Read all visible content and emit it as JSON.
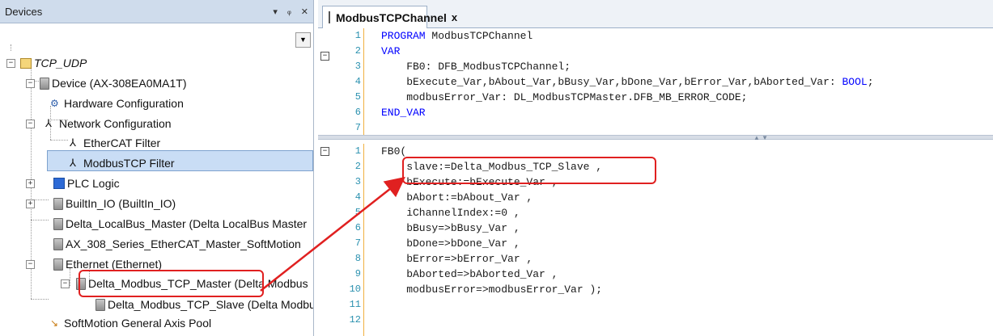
{
  "devices_panel": {
    "title": "Devices",
    "controls": [
      "▾",
      "ᵩ",
      "✕"
    ],
    "tree": [
      {
        "label": "TCP_UDP",
        "italic": true,
        "icon": "project-icon"
      },
      {
        "label": "Device (AX-308EA0MA1T)",
        "icon": "device-icon"
      },
      {
        "label": "Hardware Configuration",
        "icon": "hardware-config-icon"
      },
      {
        "label": "Network Configuration",
        "icon": "network-config-icon"
      },
      {
        "label": "EtherCAT Filter",
        "icon": "network-icon"
      },
      {
        "label": "ModbusTCP Filter",
        "icon": "network-icon"
      },
      {
        "label": "PLC Logic",
        "icon": "plc-logic-icon"
      },
      {
        "label": "BuiltIn_IO (BuiltIn_IO)",
        "icon": "device-icon"
      },
      {
        "label": "Delta_LocalBus_Master (Delta LocalBus Master",
        "icon": "device-icon"
      },
      {
        "label": "AX_308_Series_EtherCAT_Master_SoftMotion",
        "icon": "device-icon"
      },
      {
        "label": "Ethernet (Ethernet)",
        "icon": "device-icon"
      },
      {
        "label": "Delta_Modbus_TCP_Master (Delta Modbus",
        "icon": "device-icon"
      },
      {
        "label": "Delta_Modbus_TCP_Slave (Delta Modbu",
        "icon": "device-icon"
      },
      {
        "label": "SoftMotion General Axis Pool",
        "icon": "axis-pool-icon"
      }
    ]
  },
  "editor": {
    "tab_label": "ModbusTCPChannel",
    "tab_close": "x",
    "declaration": [
      {
        "n": "1",
        "segs": [
          {
            "t": "PROGRAM",
            "kw": true
          },
          {
            "t": " ModbusTCPChannel"
          }
        ]
      },
      {
        "n": "2",
        "segs": [
          {
            "t": "VAR",
            "kw": true
          }
        ]
      },
      {
        "n": "3",
        "segs": [
          {
            "t": "    FB0: DFB_ModbusTCPChannel;"
          }
        ]
      },
      {
        "n": "4",
        "segs": [
          {
            "t": "    bExecute_Var,bAbout_Var,bBusy_Var,bDone_Var,bError_Var,bAborted_Var: "
          },
          {
            "t": "BOOL",
            "kw": true
          },
          {
            "t": ";"
          }
        ]
      },
      {
        "n": "5",
        "segs": [
          {
            "t": "    modbusError_Var: DL_ModbusTCPMaster.DFB_MB_ERROR_CODE;"
          }
        ]
      },
      {
        "n": "6",
        "segs": [
          {
            "t": "END_VAR",
            "kw": true
          }
        ]
      },
      {
        "n": "7",
        "segs": []
      }
    ],
    "body": [
      {
        "n": "1",
        "segs": [
          {
            "t": "FB0("
          }
        ]
      },
      {
        "n": "2",
        "segs": [
          {
            "t": "    slave:=Delta_Modbus_TCP_Slave ,"
          }
        ]
      },
      {
        "n": "3",
        "segs": [
          {
            "t": "    bExecute:=bExecute_Var ,"
          }
        ]
      },
      {
        "n": "4",
        "segs": [
          {
            "t": "    bAbort:=bAbout_Var ,"
          }
        ]
      },
      {
        "n": "5",
        "segs": [
          {
            "t": "    iChannelIndex:=0 ,"
          }
        ]
      },
      {
        "n": "6",
        "segs": [
          {
            "t": "    bBusy=>bBusy_Var ,"
          }
        ]
      },
      {
        "n": "7",
        "segs": [
          {
            "t": "    bDone=>bDone_Var ,"
          }
        ]
      },
      {
        "n": "8",
        "segs": [
          {
            "t": "    bError=>bError_Var ,"
          }
        ]
      },
      {
        "n": "9",
        "segs": [
          {
            "t": "    bAborted=>bAborted_Var ,"
          }
        ]
      },
      {
        "n": "10",
        "segs": [
          {
            "t": "    modbusError=>modbusError_Var );"
          }
        ]
      },
      {
        "n": "11",
        "segs": []
      },
      {
        "n": "12",
        "segs": []
      }
    ]
  },
  "annotation": {
    "color": "#e02020"
  },
  "colors": {
    "keyword": "#0000ff",
    "line_number": "#2b91af",
    "selection": "#c9ddf5"
  }
}
